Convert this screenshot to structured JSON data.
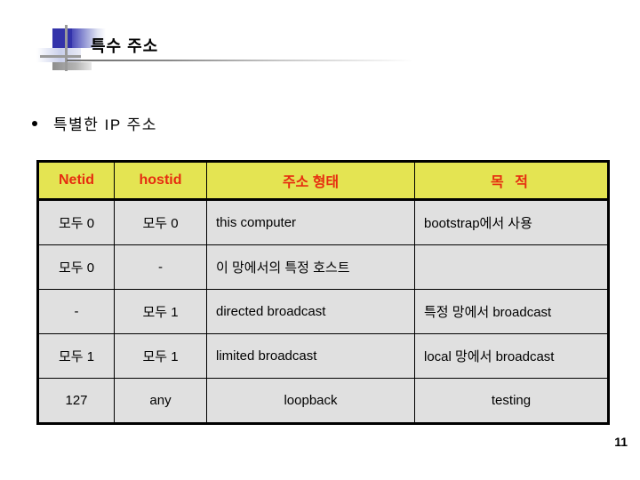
{
  "slide": {
    "title": "특수 주소",
    "page_number": "11",
    "background_color": "#ffffff"
  },
  "bullet": {
    "marker": "•",
    "text": "특별한 IP 주소"
  },
  "table": {
    "header_bg": "#e4e452",
    "header_color": "#e62d10",
    "cell_bg": "#e0e0e0",
    "headers": [
      "Netid",
      "hostid",
      "주소 형태",
      "목 적"
    ],
    "rows": [
      {
        "netid": "모두 0",
        "hostid": "모두 0",
        "form": "this computer",
        "form_align": "left",
        "purpose": "bootstrap에서 사용",
        "purpose_align": "left"
      },
      {
        "netid": "모두 0",
        "hostid": "-",
        "form": "이 망에서의 특정 호스트",
        "form_align": "left",
        "purpose": "",
        "purpose_align": "left"
      },
      {
        "netid": "-",
        "hostid": "모두 1",
        "form": "directed broadcast",
        "form_align": "left",
        "purpose": "특정 망에서 broadcast",
        "purpose_align": "left"
      },
      {
        "netid": "모두 1",
        "hostid": "모두 1",
        "form": "limited broadcast",
        "form_align": "left",
        "purpose": "local 망에서 broadcast",
        "purpose_align": "left"
      },
      {
        "netid": "127",
        "hostid": "any",
        "form": "loopback",
        "form_align": "center",
        "purpose": "testing",
        "purpose_align": "center"
      }
    ]
  }
}
